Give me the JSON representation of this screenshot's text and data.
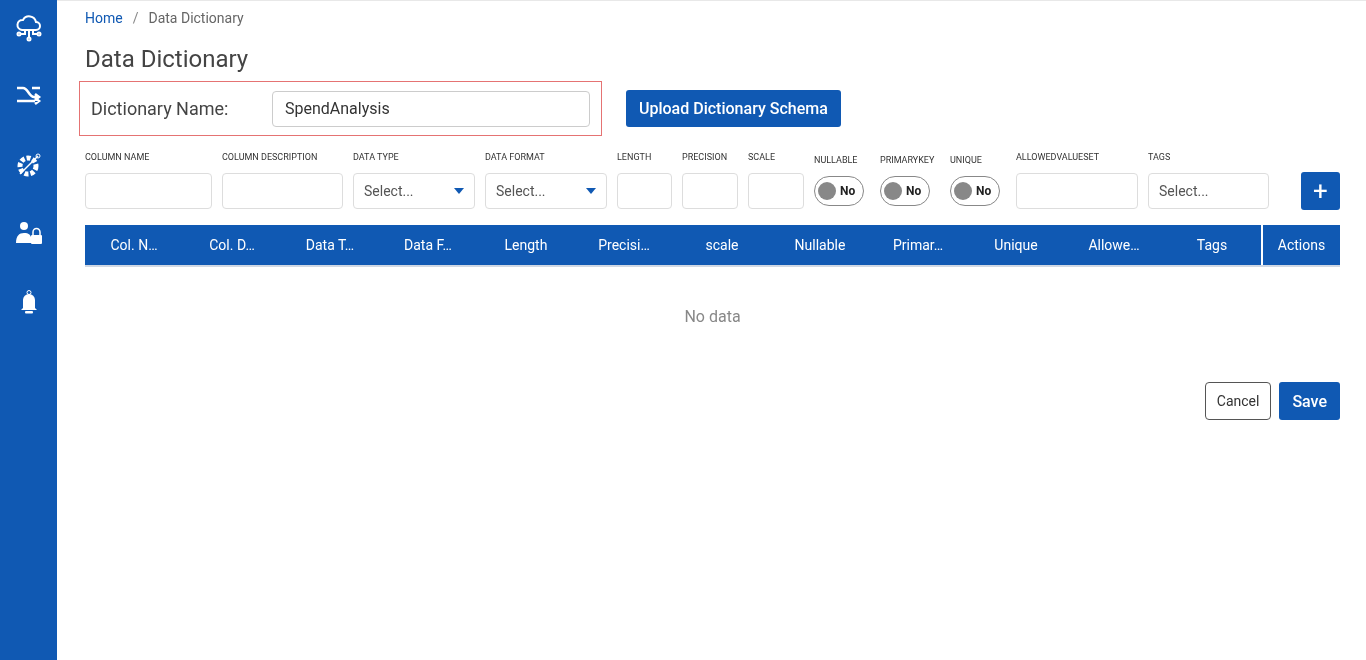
{
  "breadcrumb": {
    "items": [
      "Home",
      "Data Dictionary"
    ],
    "separator": "/"
  },
  "title": "Data Dictionary",
  "dictionary_name": {
    "label": "Dictionary Name:",
    "value": "SpendAnalysis"
  },
  "upload_button": "Upload Dictionary Schema",
  "fields": [
    {
      "label": "COLUMN NAME",
      "kind": "text"
    },
    {
      "label": "COLUMN DESCRIPTION",
      "kind": "text"
    },
    {
      "label": "DATA TYPE",
      "kind": "select",
      "placeholder": "Select..."
    },
    {
      "label": "DATA FORMAT",
      "kind": "select",
      "placeholder": "Select..."
    },
    {
      "label": "LENGTH",
      "kind": "text"
    },
    {
      "label": "PRECISION",
      "kind": "text"
    },
    {
      "label": "SCALE",
      "kind": "text"
    },
    {
      "label": "NULLABLE",
      "kind": "toggle",
      "on": false,
      "text": "No"
    },
    {
      "label": "PRIMARYKEY",
      "kind": "toggle",
      "on": false,
      "text": "No"
    },
    {
      "label": "UNIQUE",
      "kind": "toggle",
      "on": false,
      "text": "No"
    },
    {
      "label": "ALLOWEDVALUESET",
      "kind": "text"
    },
    {
      "label": "TAGS",
      "kind": "tags",
      "placeholder": "Select..."
    }
  ],
  "add_button": "+",
  "table": {
    "columns": [
      "Col. N…",
      "Col. D…",
      "Data T…",
      "Data F…",
      "Length",
      "Precisi…",
      "scale",
      "Nullable",
      "Primar…",
      "Unique",
      "Allowe…",
      "Tags"
    ],
    "actions_column": "Actions",
    "empty_text": "No data"
  },
  "buttons": {
    "cancel": "Cancel",
    "save": "Save"
  }
}
